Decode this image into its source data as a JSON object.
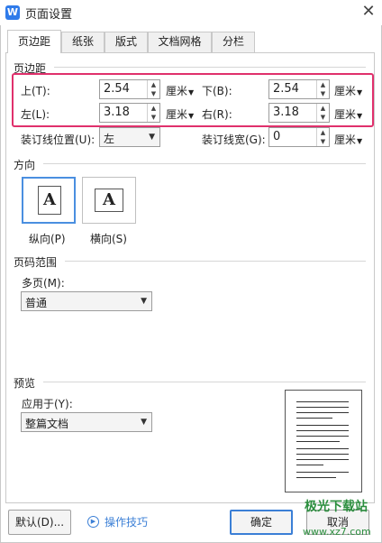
{
  "window": {
    "title": "页面设置",
    "app_icon": "W"
  },
  "tabs": [
    {
      "label": "页边距"
    },
    {
      "label": "纸张"
    },
    {
      "label": "版式"
    },
    {
      "label": "文档网格"
    },
    {
      "label": "分栏"
    }
  ],
  "margins": {
    "section": "页边距",
    "top": {
      "label": "上(T):",
      "value": "2.54",
      "unit": "厘米"
    },
    "bottom": {
      "label": "下(B):",
      "value": "2.54",
      "unit": "厘米"
    },
    "left": {
      "label": "左(L):",
      "value": "3.18",
      "unit": "厘米"
    },
    "right": {
      "label": "右(R):",
      "value": "3.18",
      "unit": "厘米"
    },
    "gutter_pos": {
      "label": "装订线位置(U):",
      "value": "左"
    },
    "gutter": {
      "label": "装订线宽(G):",
      "value": "0",
      "unit": "厘米"
    }
  },
  "orientation": {
    "section": "方向",
    "portrait": {
      "label": "纵向(P)",
      "glyph": "A",
      "selected": true
    },
    "landscape": {
      "label": "横向(S)",
      "glyph": "A",
      "selected": false
    }
  },
  "pages": {
    "section": "页码范围",
    "label": "多页(M):",
    "value": "普通"
  },
  "preview": {
    "section": "预览",
    "apply_label": "应用于(Y):",
    "apply_value": "整篇文档"
  },
  "footer": {
    "default_btn": "默认(D)...",
    "tips_link": "操作技巧",
    "ok_btn": "确定",
    "cancel_btn": "取消"
  },
  "watermark": {
    "title": "极光下载站",
    "url": "www.xz7.com"
  },
  "colors": {
    "highlight": "#e0306c",
    "accent": "#3b7fd6",
    "watermark": "#2b8e3e"
  }
}
